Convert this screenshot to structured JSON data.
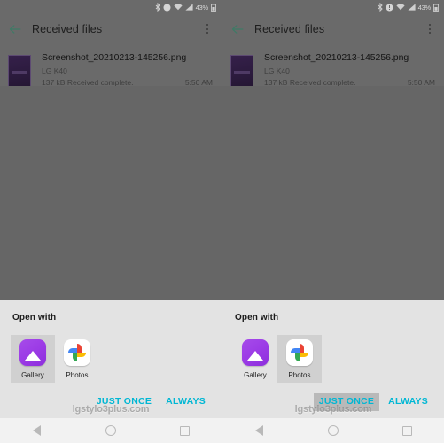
{
  "meta": {
    "watermark": "lgstylo3plus.com"
  },
  "status_bar": {
    "battery_percent": "43%",
    "icons": [
      "bluetooth-icon",
      "alarm-icon",
      "wifi-icon",
      "signal-icon",
      "battery-icon"
    ]
  },
  "app_bar": {
    "title": "Received files",
    "back_icon": "back-arrow-icon",
    "overflow_icon": "overflow-menu-icon"
  },
  "file": {
    "name": "Screenshot_20210213-145256.png",
    "device": "LG K40",
    "status": "137 kB Received complete.",
    "time": "5:50 AM"
  },
  "dialog": {
    "title": "Open with",
    "apps": [
      {
        "label": "Gallery",
        "icon": "gallery-icon"
      },
      {
        "label": "Photos",
        "icon": "google-photos-icon"
      }
    ],
    "just_once_label": "JUST ONCE",
    "always_label": "ALWAYS"
  },
  "panels": [
    {
      "selected_app_index": 0,
      "just_once_pressed": false
    },
    {
      "selected_app_index": 1,
      "just_once_pressed": true
    }
  ],
  "nav_bar": {
    "back_label": "back-nav-button",
    "home_label": "home-nav-button",
    "recents_label": "recents-nav-button"
  },
  "colors": {
    "accent": "#00b7d4",
    "scrim": "#666666",
    "sheet_bg": "#e3e3e3",
    "gallery_purple": "#9c3ce6"
  }
}
